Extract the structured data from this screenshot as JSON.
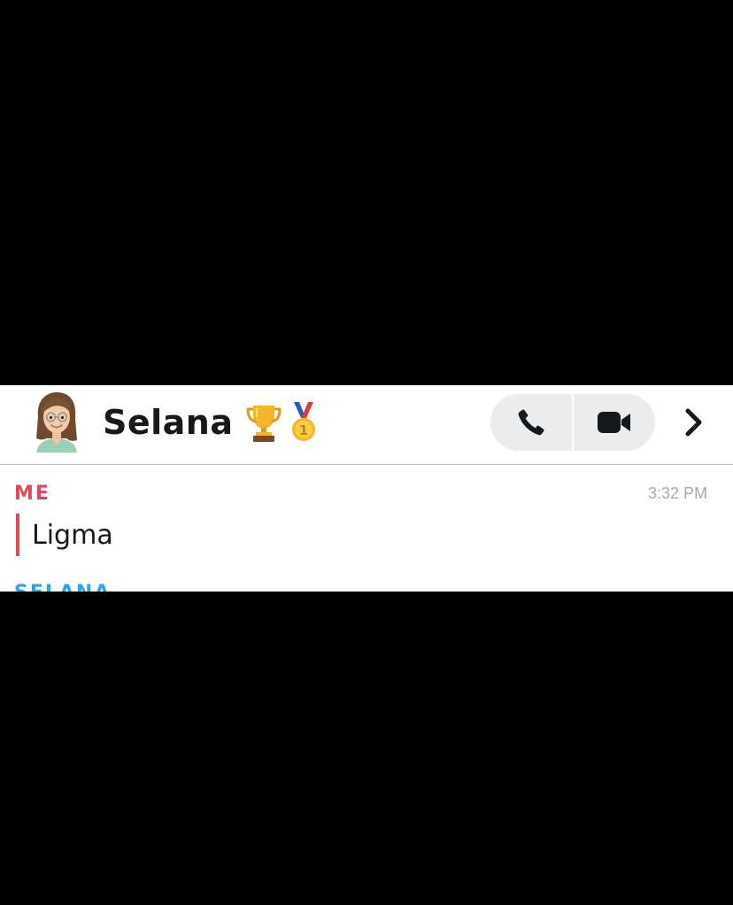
{
  "header": {
    "contact_name": "Selana",
    "badges": [
      "trophy-emoji",
      "first-place-medal-emoji"
    ],
    "avatar": "bitmoji-avatar"
  },
  "actions": {
    "voice_call": "phone-icon",
    "video_call": "video-camera-icon",
    "profile": "chevron-right-icon"
  },
  "messages": [
    {
      "sender": "ME",
      "time": "3:32 PM",
      "text": "Ligma",
      "accent": "#e04b5c"
    }
  ],
  "next_message": {
    "sender": "SELANA",
    "accent": "#2fa3e6"
  },
  "colors": {
    "background": "#000000",
    "panel": "#ffffff",
    "button_bg": "#ebecee",
    "text": "#16191c",
    "muted": "#a6a9ad"
  }
}
